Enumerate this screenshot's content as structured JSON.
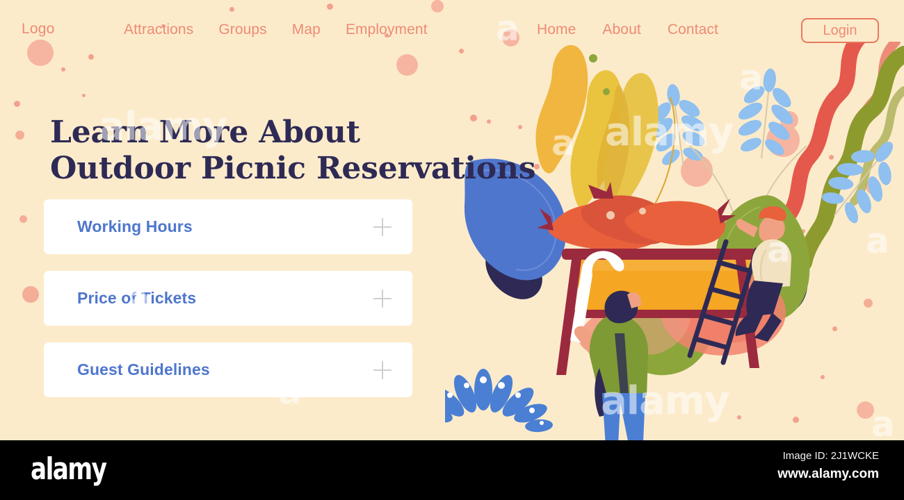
{
  "page": {
    "background_color": "#fcebcb",
    "accent_color": "#ee8b74",
    "heading_color": "#2e2a55",
    "accordion_label_color": "#4f76cd"
  },
  "nav": {
    "logo": "Logo",
    "left_links": [
      {
        "label": "Attractions"
      },
      {
        "label": "Groups"
      },
      {
        "label": "Map"
      },
      {
        "label": "Employment"
      }
    ],
    "right_links": [
      {
        "label": "Home"
      },
      {
        "label": "About"
      },
      {
        "label": "Contact"
      }
    ],
    "login_label": "Login"
  },
  "hero": {
    "heading_line1": "Learn More About",
    "heading_line2": "Outdoor Picnic Reservations"
  },
  "accordion": {
    "items": [
      {
        "label": "Working Hours",
        "icon": "plus-icon"
      },
      {
        "label": "Price of Tickets",
        "icon": "plus-icon"
      },
      {
        "label": "Guest Guidelines",
        "icon": "plus-icon"
      }
    ]
  },
  "illustration": {
    "description": "Flat vector illustration of a giant outdoor barbecue grill with sausages, two tiny people, a ladder, and oversized foliage",
    "colors": {
      "grill_body": "#f5a623",
      "grill_frame": "#9c2a3e",
      "sausage": "#e8613c",
      "leaf_blue": "#4f76cd",
      "leaf_light_blue": "#8fc0ef",
      "leaf_green": "#8da63c",
      "leaf_yellow": "#f0b63f",
      "squiggle_red": "#e4594b",
      "squiggle_olive": "#8d9b2e",
      "blob_coral": "#f2836d",
      "dark_navy": "#2e2a55"
    }
  },
  "watermarks": [
    {
      "text": "alamy"
    },
    {
      "text": "a"
    }
  ],
  "footer": {
    "brand": "alamy",
    "image_id": "Image ID: 2J1WCKE",
    "url": "www.alamy.com"
  }
}
